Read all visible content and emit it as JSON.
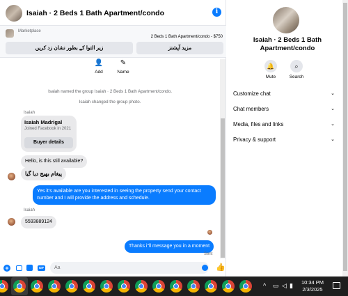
{
  "chat": {
    "title": "Isaiah · 2 Beds 1 Bath Apartment/condo",
    "marketplace_label": "Marketplace",
    "listing": "2 Beds 1 Bath Apartment/condo - $750",
    "button_urdu_1": "زیر التوا کے بطور نشان زد کریں",
    "button_urdu_2": "مزید آپشنز",
    "add_label": "Add",
    "name_label": "Name",
    "system_1": "Isaiah named the group Isaiah · 2 Beds 1 Bath Apartment/condo.",
    "system_2": "Isaiah changed the group photo.",
    "sender_1": "Isaiah",
    "card_name": "Isaiah Madrigal",
    "card_sub": "Joined Facebook in 2021",
    "buyer_details": "Buyer details",
    "msg_1": "Hello, is this still available?",
    "msg_2": "پیغام بھیج دیا گیا",
    "msg_3": "Yes it's available are you interested in seeing the property send your contact number and I will provide the address and schedule.",
    "sender_2": "Isaiah",
    "msg_4": "5593889124",
    "msg_5": "Thanks i\"ll message you in a moment",
    "sent_label": "Sent",
    "input_placeholder": "Aa"
  },
  "panel": {
    "title": "Isaiah · 2 Beds 1 Bath Apartment/condo",
    "mute_label": "Mute",
    "search_label": "Search",
    "rows": [
      "Customize chat",
      "Chat members",
      "Media, files and links",
      "Privacy & support"
    ]
  },
  "taskbar": {
    "time": "10:34 PM",
    "date": "2/3/2025"
  },
  "icons": {
    "info": "info-icon",
    "bell": "bell-icon",
    "search": "search-icon",
    "like": "thumbs-up-icon"
  }
}
